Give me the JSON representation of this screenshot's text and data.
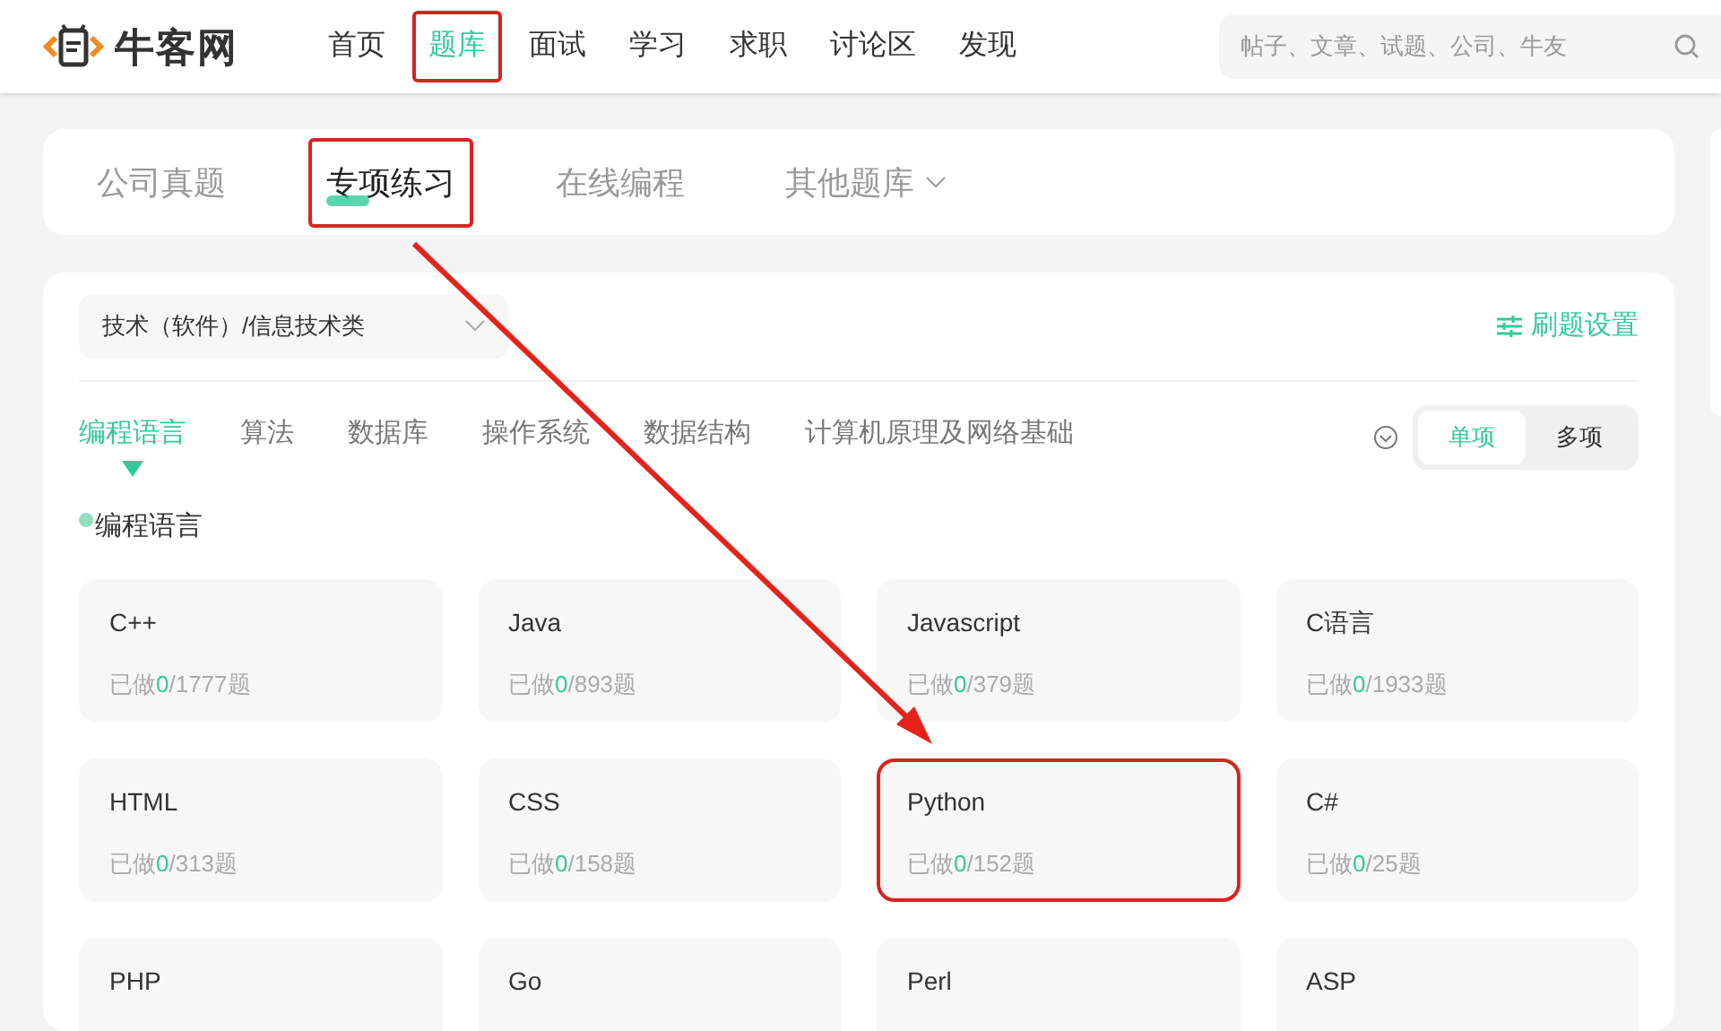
{
  "header": {
    "logo": "牛客网",
    "nav": [
      {
        "label": "首页",
        "selected": false,
        "highlighted": false
      },
      {
        "label": "题库",
        "selected": true,
        "highlighted": true
      },
      {
        "label": "面试",
        "selected": false,
        "highlighted": false
      },
      {
        "label": "学习",
        "selected": false,
        "highlighted": false
      },
      {
        "label": "求职",
        "selected": false,
        "highlighted": false
      },
      {
        "label": "讨论区",
        "selected": false,
        "highlighted": false
      },
      {
        "label": "发现",
        "selected": false,
        "highlighted": false
      }
    ],
    "search": {
      "placeholder": "帖子、文章、试题、公司、牛友"
    }
  },
  "tabs": [
    {
      "label": "公司真题",
      "selected": false,
      "highlighted": false,
      "dropdown": false
    },
    {
      "label": "专项练习",
      "selected": true,
      "highlighted": true,
      "dropdown": false
    },
    {
      "label": "在线编程",
      "selected": false,
      "highlighted": false,
      "dropdown": false
    },
    {
      "label": "其他题库",
      "selected": false,
      "highlighted": false,
      "dropdown": true
    }
  ],
  "category_select": {
    "value": "技术（软件）/信息技术类"
  },
  "settings_link": "刷题设置",
  "subjects": [
    {
      "label": "编程语言",
      "selected": true
    },
    {
      "label": "算法",
      "selected": false
    },
    {
      "label": "数据库",
      "selected": false
    },
    {
      "label": "操作系统",
      "selected": false
    },
    {
      "label": "数据结构",
      "selected": false
    },
    {
      "label": "计算机原理及网络基础",
      "selected": false
    }
  ],
  "mode": [
    {
      "label": "单项",
      "selected": true
    },
    {
      "label": "多项",
      "selected": false
    }
  ],
  "section_title": "编程语言",
  "cards": [
    {
      "name": "C++",
      "done_label": "已做",
      "done": "0",
      "total": "/1777题",
      "highlighted": false
    },
    {
      "name": "Java",
      "done_label": "已做",
      "done": "0",
      "total": "/893题",
      "highlighted": false
    },
    {
      "name": "Javascript",
      "done_label": "已做",
      "done": "0",
      "total": "/379题",
      "highlighted": false
    },
    {
      "name": "C语言",
      "done_label": "已做",
      "done": "0",
      "total": "/1933题",
      "highlighted": false
    },
    {
      "name": "HTML",
      "done_label": "已做",
      "done": "0",
      "total": "/313题",
      "highlighted": false
    },
    {
      "name": "CSS",
      "done_label": "已做",
      "done": "0",
      "total": "/158题",
      "highlighted": false
    },
    {
      "name": "Python",
      "done_label": "已做",
      "done": "0",
      "total": "/152题",
      "highlighted": true
    },
    {
      "name": "C#",
      "done_label": "已做",
      "done": "0",
      "total": "/25题",
      "highlighted": false
    },
    {
      "name": "PHP",
      "highlighted": false
    },
    {
      "name": "Go",
      "highlighted": false
    },
    {
      "name": "Perl",
      "highlighted": false
    },
    {
      "name": "ASP",
      "highlighted": false
    }
  ],
  "annotation_arrow": true
}
